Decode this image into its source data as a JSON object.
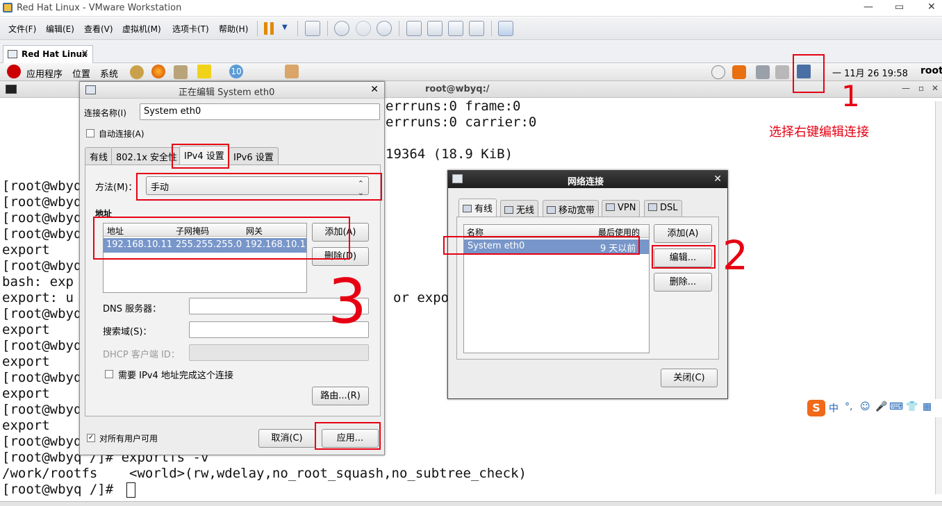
{
  "window": {
    "title": "Red Hat Linux - VMware Workstation",
    "minimize": "—",
    "restore": "▭",
    "close": "✕"
  },
  "menubar": {
    "items": [
      "文件(F)",
      "编辑(E)",
      "查看(V)",
      "虚拟机(M)",
      "选项卡(T)",
      "帮助(H)"
    ]
  },
  "tabs": {
    "vm_tab": "Red Hat Linux",
    "close": "✕"
  },
  "gnome_panel": {
    "menus": [
      "应用程序",
      "位置",
      "系统"
    ],
    "clock": "一 11月 26 19:58",
    "user": "root",
    "badge": "10"
  },
  "terminal": {
    "title": "root@wbyq:/",
    "lines": [
      "errruns:0 frame:0",
      "errruns:0 carrier:0",
      "",
      "19364 (18.9 KiB)"
    ],
    "left_lines": [
      "[root@wbyq",
      "[root@wbyq",
      "[root@wbyq",
      "[root@wbyq",
      "export",
      "[root@wbyq",
      "bash: exp",
      "export: u",
      "[root@wbyq",
      "export",
      "[root@wbyq",
      "export",
      "[root@wbyq",
      "export",
      "[root@wbyq",
      "export",
      "[root@wbyq"
    ],
    "export_tail": "or expo",
    "bottom_lines": [
      "[root@wbyq /]# exportfs -v",
      "/work/rootfs    <world>(rw,wdelay,no_root_squash,no_subtree_check)",
      "[root@wbyq /]# "
    ]
  },
  "edit_dialog": {
    "title": "正在编辑 System eth0",
    "close": "✕",
    "conn_name_label": "连接名称(I)",
    "conn_name_value": "System eth0",
    "auto_connect_label": "自动连接(A)",
    "tabs": [
      "有线",
      "802.1x 安全性",
      "IPv4 设置",
      "IPv6 设置"
    ],
    "method_label": "方法(M)：",
    "method_value": "手动",
    "address_section": "地址",
    "columns": [
      "地址",
      "子网掩码",
      "网关"
    ],
    "row": [
      "192.168.10.11",
      "255.255.255.0",
      "192.168.10.1"
    ],
    "add_button": "添加(A)",
    "delete_button": "删除(D)",
    "dns_label": "DNS 服务器：",
    "search_label": "搜索域(S)：",
    "dhcp_label": "DHCP 客户端 ID：",
    "require_ipv4_label": "需要 IPv4 地址完成这个连接",
    "routes_button": "路由...(R)",
    "all_users_label": "对所有用户可用",
    "cancel_button": "取消(C)",
    "apply_button": "应用..."
  },
  "net_dialog": {
    "title": "网络连接",
    "close": "✕",
    "tabs": [
      "有线",
      "无线",
      "移动宽带",
      "VPN",
      "DSL"
    ],
    "columns": [
      "名称",
      "最后使用的"
    ],
    "row": [
      "System eth0",
      "9 天以前"
    ],
    "add_button": "添加(A)",
    "edit_button": "编辑...",
    "delete_button": "删除...",
    "close_button": "关闭(C)"
  },
  "annotations": {
    "note": "选择右键编辑连接",
    "step1": "1",
    "step2": "2",
    "step3": "3"
  },
  "ime": {
    "logo": "S",
    "items": [
      "中",
      "°,",
      "☺",
      "🎤",
      "⌨",
      "👕",
      "▦"
    ]
  },
  "colors": {
    "selection": "#7896c9",
    "annotation": "#e60012",
    "dark_title": "#1e1e1e"
  }
}
